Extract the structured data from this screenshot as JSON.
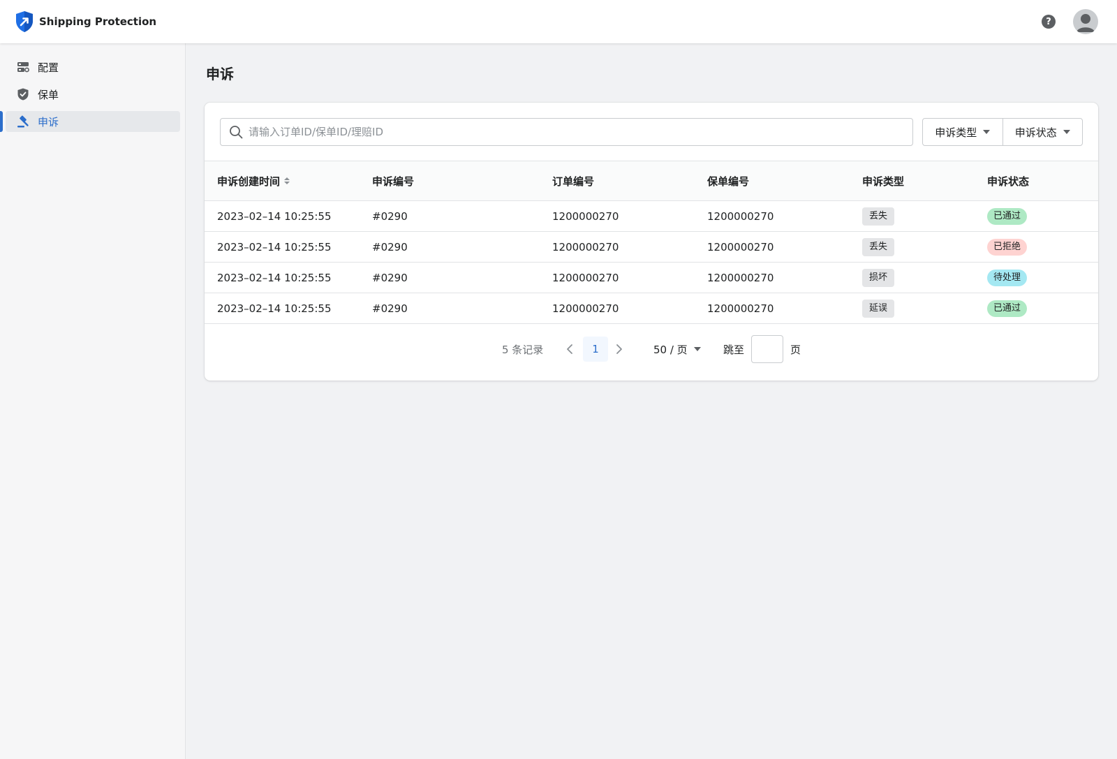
{
  "app": {
    "name": "Shipping Protection",
    "help_label": "?"
  },
  "colors": {
    "accent": "#2c6ecb",
    "status_approved": "#aee9c4",
    "status_rejected": "#fed3d1",
    "status_pending": "#a4e8f2",
    "tag_gray": "#e4e5e7"
  },
  "sidebar": {
    "items": [
      {
        "label": "配置",
        "icon": "config-icon",
        "active": false
      },
      {
        "label": "保单",
        "icon": "shield-check-icon",
        "active": false
      },
      {
        "label": "申诉",
        "icon": "gavel-icon",
        "active": true
      }
    ]
  },
  "page": {
    "title": "申诉"
  },
  "search": {
    "placeholder": "请输入订单ID/保单ID/理赔ID",
    "value": ""
  },
  "filters": {
    "type_label": "申诉类型",
    "status_label": "申诉状态"
  },
  "table": {
    "headers": [
      "申诉创建时间",
      "申诉编号",
      "订单编号",
      "保单编号",
      "申诉类型",
      "申诉状态"
    ],
    "rows": [
      {
        "created": "2023–02–14 10:25:55",
        "appeal_id": "#0290",
        "order_id": "1200000270",
        "policy_id": "1200000270",
        "type": "丢失",
        "status": "已通过",
        "status_kind": "approved"
      },
      {
        "created": "2023–02–14 10:25:55",
        "appeal_id": "#0290",
        "order_id": "1200000270",
        "policy_id": "1200000270",
        "type": "丢失",
        "status": "已拒绝",
        "status_kind": "rejected"
      },
      {
        "created": "2023–02–14 10:25:55",
        "appeal_id": "#0290",
        "order_id": "1200000270",
        "policy_id": "1200000270",
        "type": "损坏",
        "status": "待处理",
        "status_kind": "pending"
      },
      {
        "created": "2023–02–14 10:25:55",
        "appeal_id": "#0290",
        "order_id": "1200000270",
        "policy_id": "1200000270",
        "type": "延误",
        "status": "已通过",
        "status_kind": "approved"
      }
    ]
  },
  "pagination": {
    "total_text": "5 条记录",
    "current_page": "1",
    "page_size": "50 / 页",
    "jump_label": "跳至",
    "jump_suffix": "页",
    "jump_value": ""
  }
}
